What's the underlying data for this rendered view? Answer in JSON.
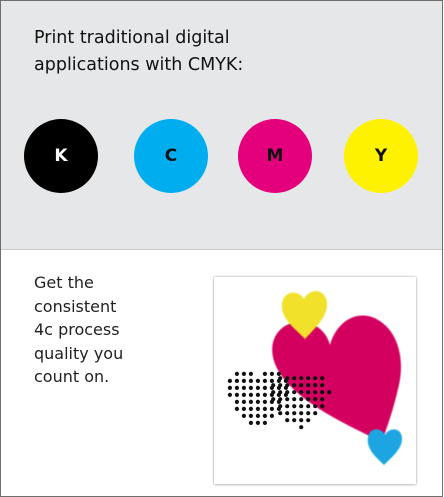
{
  "header": {
    "line1": "Print traditional digital",
    "line2": "applications with CMYK:"
  },
  "inks": [
    {
      "label": "K",
      "color": "#000000"
    },
    {
      "label": "C",
      "color": "#00aeef"
    },
    {
      "label": "M",
      "color": "#e4007c"
    },
    {
      "label": "Y",
      "color": "#fff200"
    }
  ],
  "body": {
    "lines": [
      "Get the",
      "consistent",
      "4c process",
      "quality you",
      "count on."
    ]
  },
  "sample_image": {
    "icon": "hearts-print-sample",
    "colors": {
      "magenta": "#d4005f",
      "yellow": "#f1e12a",
      "cyan": "#1aa5e1",
      "black": "#111111"
    }
  }
}
